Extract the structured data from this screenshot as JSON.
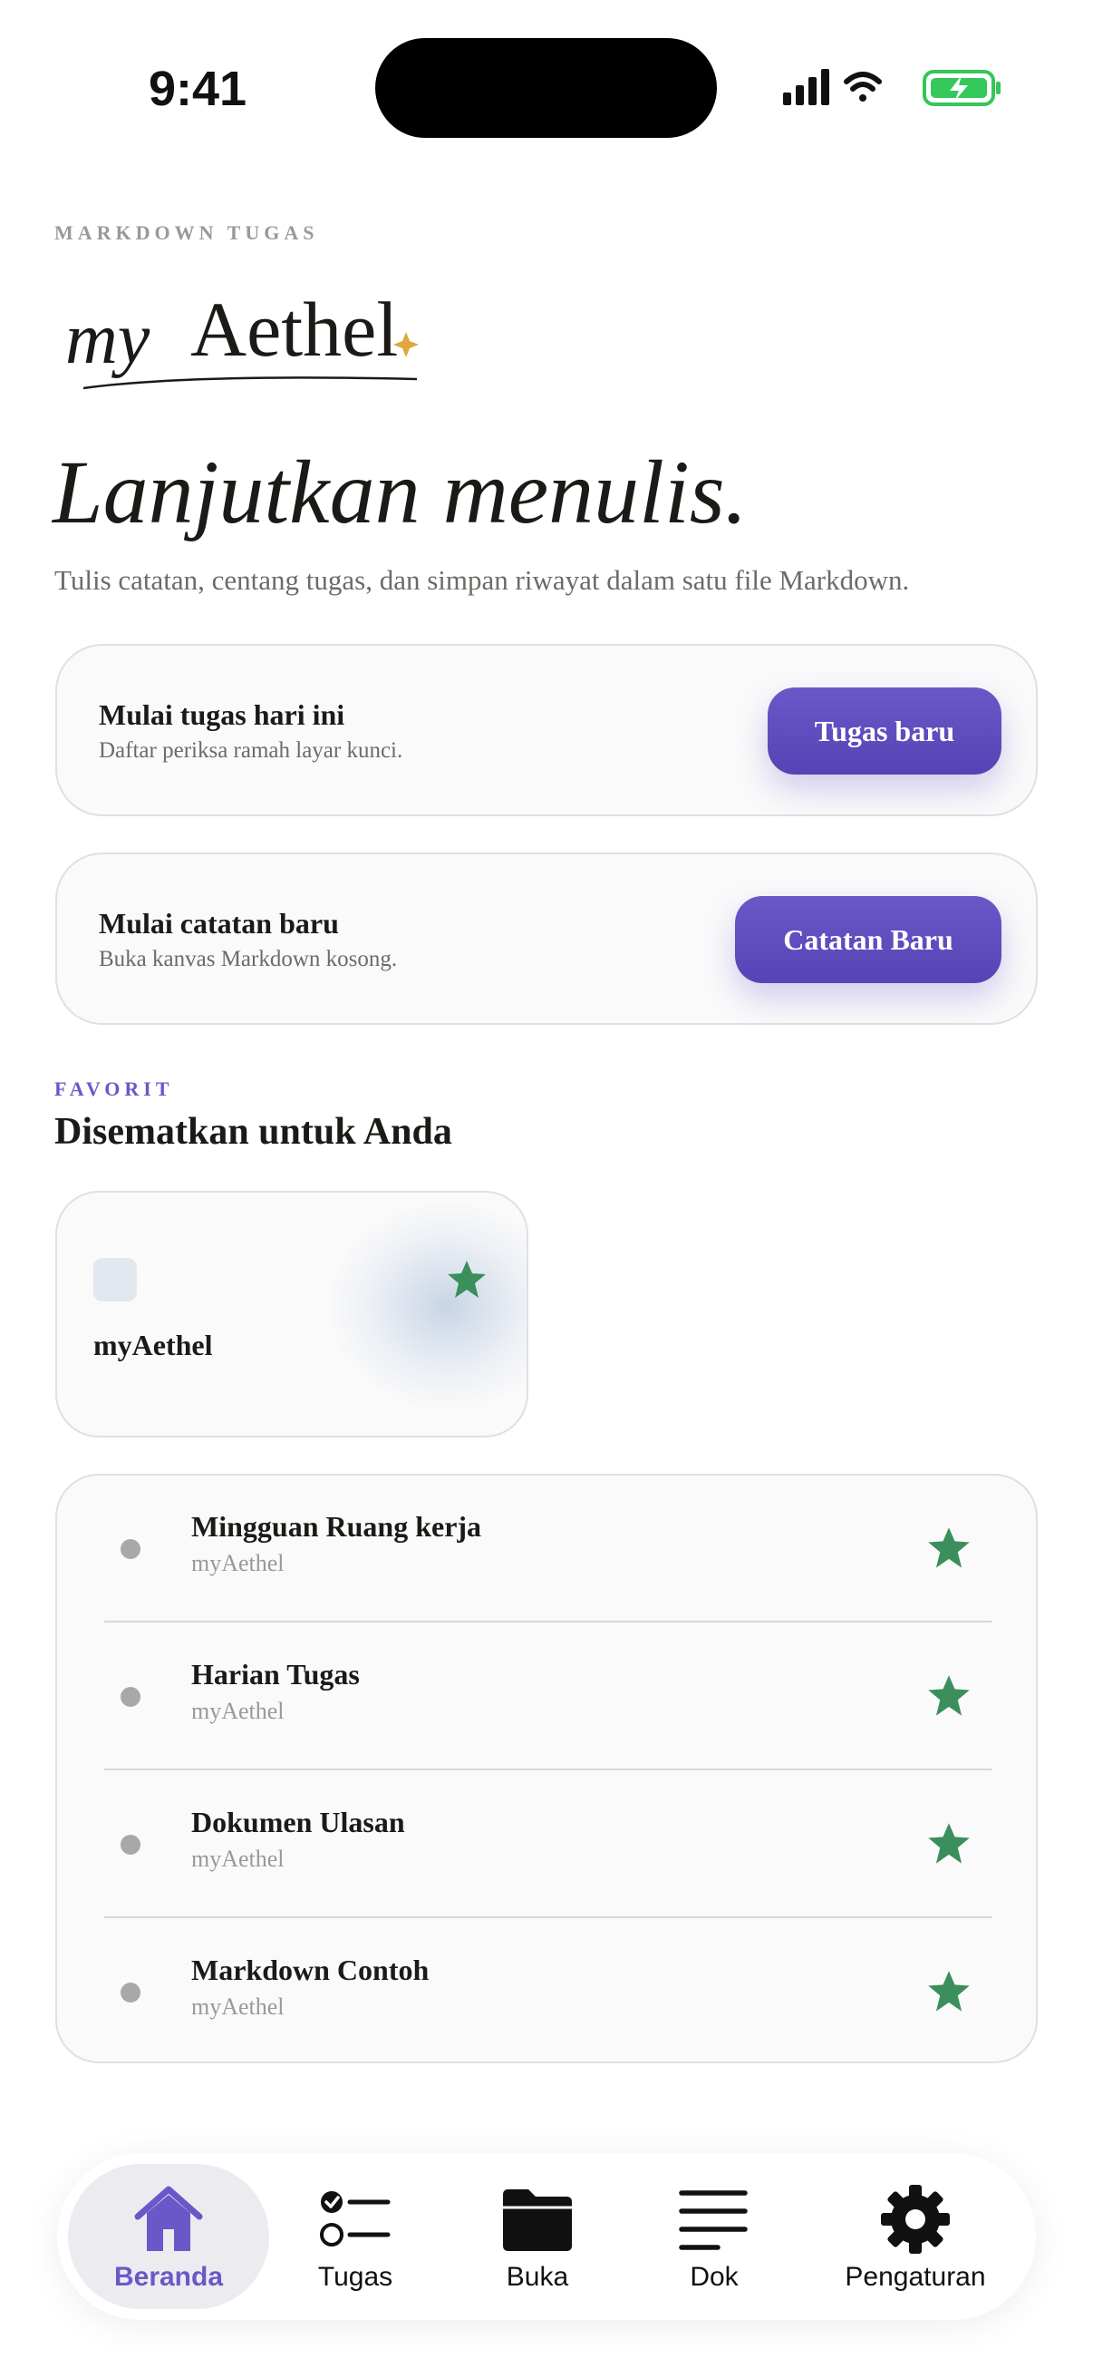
{
  "status_bar": {
    "time": "9:41"
  },
  "header": {
    "eyebrow": "MARKDOWN TUGAS",
    "logo_text": "myAethel",
    "headline": "Lanjutkan menulis.",
    "subline": "Tulis catatan, centang tugas, dan simpan riwayat dalam satu file Markdown."
  },
  "actions": [
    {
      "title": "Mulai tugas hari ini",
      "subtitle": "Daftar periksa ramah layar kunci.",
      "button": "Tugas baru"
    },
    {
      "title": "Mulai catatan baru",
      "subtitle": "Buka kanvas Markdown kosong.",
      "button": "Catatan Baru"
    }
  ],
  "favorites": {
    "eyebrow": "FAVORIT",
    "heading": "Disematkan untuk Anda",
    "pinned": {
      "title": "myAethel",
      "starred": true
    }
  },
  "list": [
    {
      "title": "Mingguan Ruang kerja",
      "subtitle": "myAethel",
      "starred": true
    },
    {
      "title": "Harian Tugas",
      "subtitle": "myAethel",
      "starred": true
    },
    {
      "title": "Dokumen Ulasan",
      "subtitle": "myAethel",
      "starred": true
    },
    {
      "title": "Markdown Contoh",
      "subtitle": "myAethel",
      "starred": true
    }
  ],
  "tabbar": {
    "tabs": [
      {
        "label": "Beranda",
        "icon": "home-icon",
        "active": true
      },
      {
        "label": "Tugas",
        "icon": "checklist-icon",
        "active": false
      },
      {
        "label": "Buka",
        "icon": "folder-icon",
        "active": false
      },
      {
        "label": "Dok",
        "icon": "document-lines-icon",
        "active": false
      },
      {
        "label": "Pengaturan",
        "icon": "gear-icon",
        "active": false
      }
    ]
  },
  "colors": {
    "accent": "#6a58c8",
    "star": "#3a8f5c",
    "text": "#1c1a17",
    "muted": "#6d6b67",
    "logo_sparkle": "#e0a640",
    "battery": "#34c759"
  }
}
